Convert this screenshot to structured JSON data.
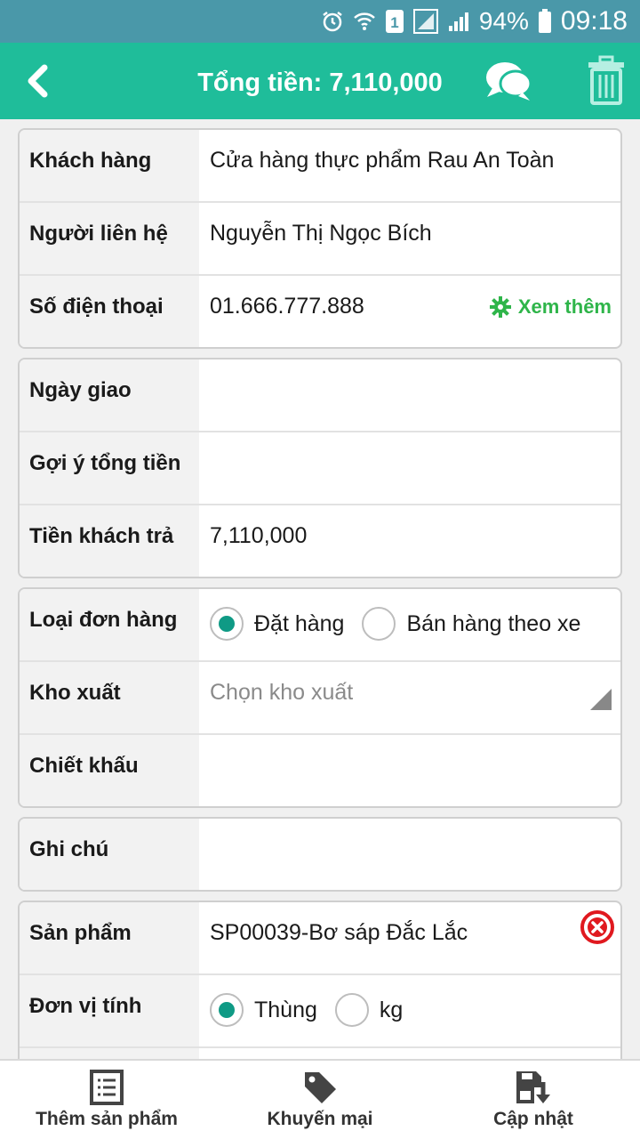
{
  "status_bar": {
    "battery": "94%",
    "time": "09:18",
    "sim_badge": "1"
  },
  "header": {
    "title": "Tổng tiền: 7,110,000"
  },
  "customer": {
    "customer_label": "Khách hàng",
    "customer_value": "Cửa hàng thực phẩm Rau An Toàn",
    "contact_label": "Người liên hệ",
    "contact_value": "Nguyễn Thị Ngọc Bích",
    "phone_label": "Số điện thoại",
    "phone_value": "01.666.777.888",
    "more_label": "Xem thêm"
  },
  "payment": {
    "delivery_label": "Ngày giao",
    "delivery_value": "",
    "suggest_label": "Gợi ý tổng tiền",
    "suggest_value": "",
    "paid_label": "Tiền khách trả",
    "paid_value": "7,110,000"
  },
  "order": {
    "type_label": "Loại đơn hàng",
    "type_options": [
      {
        "label": "Đặt hàng",
        "checked": true
      },
      {
        "label": "Bán hàng theo xe",
        "checked": false
      }
    ],
    "warehouse_label": "Kho xuất",
    "warehouse_placeholder": "Chọn kho xuất",
    "discount_label": "Chiết khấu",
    "discount_value": ""
  },
  "note": {
    "label": "Ghi chú",
    "value": ""
  },
  "product": {
    "product_label": "Sản phẩm",
    "product_value": "SP00039-Bơ sáp Đắc Lắc",
    "unit_label": "Đơn vị tính",
    "unit_options": [
      {
        "label": "Thùng",
        "checked": true
      },
      {
        "label": "kg",
        "checked": false
      }
    ]
  },
  "bottom_bar": {
    "add_product": "Thêm sản phẩm",
    "promotion": "Khuyến mại",
    "update": "Cập nhật"
  },
  "colors": {
    "header_bg": "#1fbd9a",
    "status_bar_bg": "#4a98a9",
    "accent_green": "#2fb54a",
    "radio_checked": "#0f9a85",
    "remove_red": "#e0191f"
  }
}
